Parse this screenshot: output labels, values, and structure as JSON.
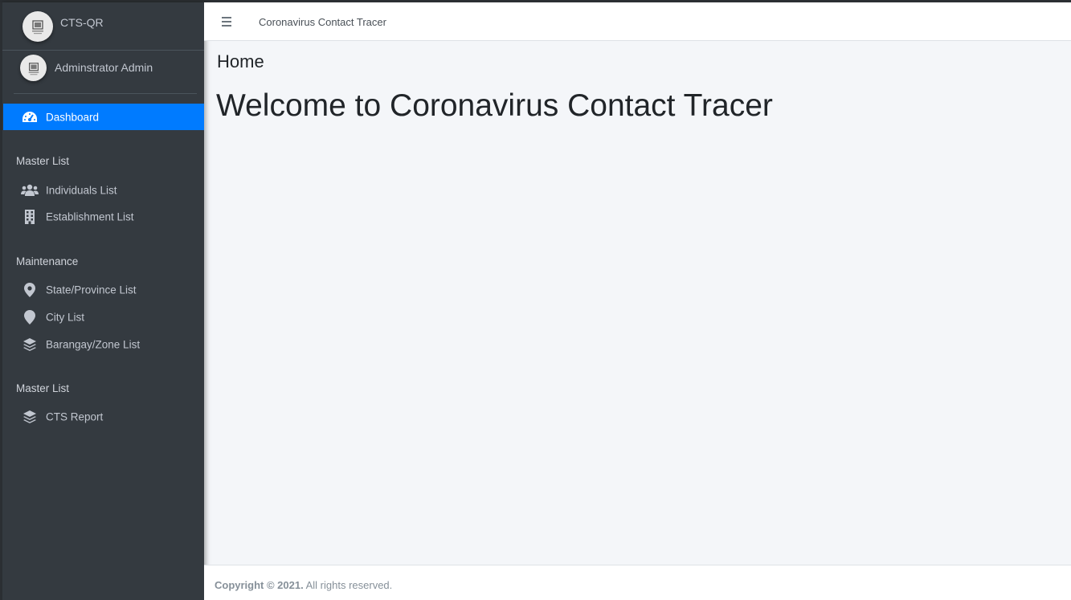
{
  "brand": {
    "name": "CTS-QR",
    "logo_icon": "image-not-available-icon"
  },
  "user": {
    "name": "Adminstrator Admin",
    "avatar_icon": "image-not-available-icon"
  },
  "sidebar": {
    "dashboard": {
      "label": "Dashboard",
      "icon": "tachometer-icon"
    },
    "section1": {
      "header": "Master List",
      "items": [
        {
          "label": "Individuals List",
          "icon": "users-icon"
        },
        {
          "label": "Establishment List",
          "icon": "building-icon"
        }
      ]
    },
    "section2": {
      "header": "Maintenance",
      "items": [
        {
          "label": "State/Province List",
          "icon": "map-marker-icon"
        },
        {
          "label": "City List",
          "icon": "map-pin-icon"
        },
        {
          "label": "Barangay/Zone List",
          "icon": "layers-icon"
        }
      ]
    },
    "section3": {
      "header": "Master List",
      "items": [
        {
          "label": "CTS Report",
          "icon": "layers-icon"
        }
      ]
    }
  },
  "navbar": {
    "title": "Coronavirus Contact Tracer",
    "menu_icon": "hamburger-icon"
  },
  "main": {
    "heading": "Home",
    "welcome": "Welcome to Coronavirus Contact Tracer"
  },
  "footer": {
    "copyright": "Copyright © 2021.",
    "rights": " All rights reserved."
  },
  "colors": {
    "sidebar_bg": "#343a40",
    "accent": "#007bff",
    "content_bg": "#f4f6f9"
  }
}
